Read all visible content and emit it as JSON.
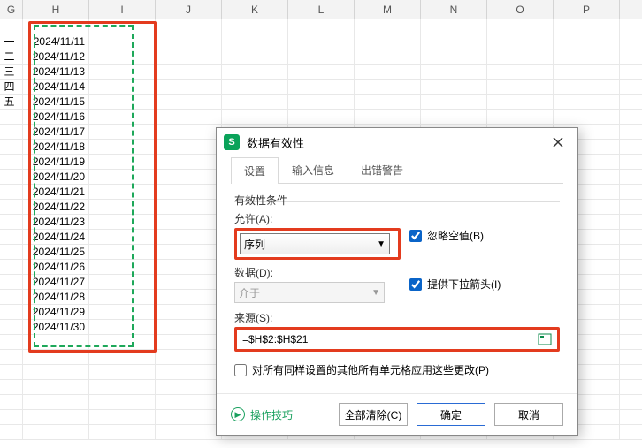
{
  "columns": [
    "G",
    "H",
    "I",
    "J",
    "K",
    "L",
    "M",
    "N",
    "O",
    "P"
  ],
  "rowG": [
    "一",
    "二",
    "三",
    "四",
    "五"
  ],
  "dates": [
    "2024/11/11",
    "2024/11/12",
    "2024/11/13",
    "2024/11/14",
    "2024/11/15",
    "2024/11/16",
    "2024/11/17",
    "2024/11/18",
    "2024/11/19",
    "2024/11/20",
    "2024/11/21",
    "2024/11/22",
    "2024/11/23",
    "2024/11/24",
    "2024/11/25",
    "2024/11/26",
    "2024/11/27",
    "2024/11/28",
    "2024/11/29",
    "2024/11/30"
  ],
  "dialog": {
    "title": "数据有效性",
    "tabs": [
      "设置",
      "输入信息",
      "出错警告"
    ],
    "fieldset_label": "有效性条件",
    "allow_label": "允许(A):",
    "allow_value": "序列",
    "data_label": "数据(D):",
    "data_value": "介于",
    "source_label": "来源(S):",
    "source_value": "=$H$2:$H$21",
    "ignore_blank": "忽略空值(B)",
    "dropdown_arrow": "提供下拉箭头(I)",
    "apply_all": "对所有同样设置的其他所有单元格应用这些更改(P)",
    "tips": "操作技巧",
    "clear": "全部清除(C)",
    "ok": "确定",
    "cancel": "取消"
  }
}
